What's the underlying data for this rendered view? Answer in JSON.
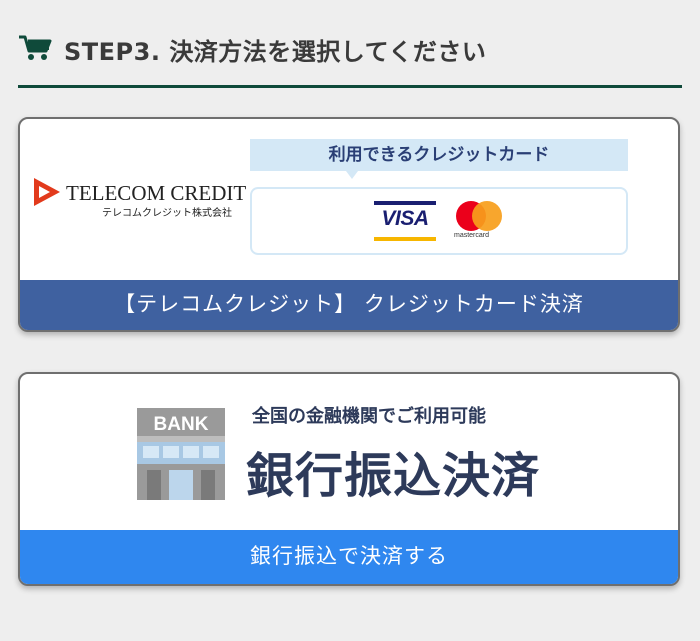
{
  "header": {
    "title": "STEP3. 決済方法を選択してください",
    "icon": "cart-icon",
    "accent_color": "#0f4a3a"
  },
  "credit": {
    "logo_name": "TELECOM CREDIT",
    "logo_sub": "テレコムクレジット株式会社",
    "available_label": "利用できるクレジットカード",
    "visa": "VISA",
    "mastercard": "mastercard",
    "button_label": "【テレコムクレジット】 クレジットカード決済",
    "bar_color": "#3f61a0"
  },
  "bank": {
    "subtitle": "全国の金融機関でご利用可能",
    "title": "銀行振込決済",
    "icon_label": "BANK",
    "button_label": "銀行振込で決済する",
    "bar_color": "#2f87ef"
  }
}
